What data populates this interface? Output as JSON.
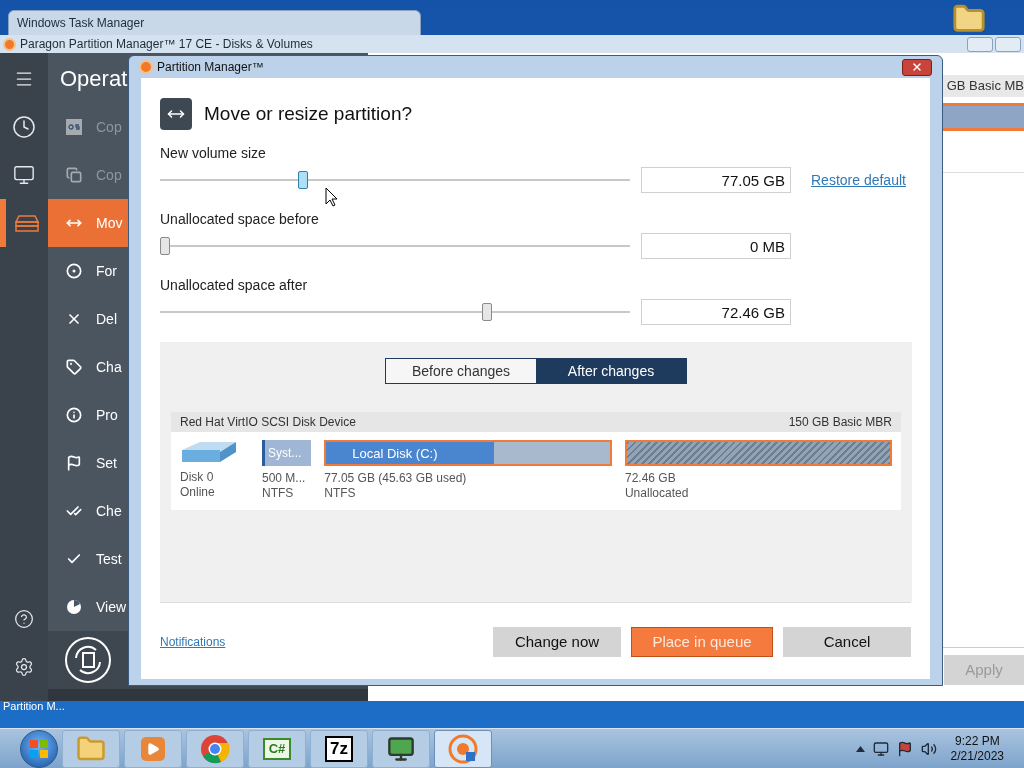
{
  "background_window": {
    "title": "Windows Task Manager"
  },
  "main_window": {
    "title": "Paragon Partition Manager™ 17 CE - Disks & Volumes",
    "rail": [
      {
        "kind": "menu",
        "selected": false
      },
      {
        "kind": "history",
        "selected": false
      },
      {
        "kind": "monitors",
        "selected": false
      },
      {
        "kind": "disks",
        "selected": true
      },
      {
        "kind": "help",
        "selected": false
      },
      {
        "kind": "settings",
        "selected": false
      }
    ],
    "panel": {
      "title": "Operat",
      "items": [
        {
          "kind": "os",
          "label": "Cop",
          "selected": false,
          "disabled": true
        },
        {
          "kind": "copy",
          "label": "Cop",
          "selected": false,
          "disabled": true
        },
        {
          "kind": "move",
          "label": "Mov",
          "selected": true,
          "disabled": false
        },
        {
          "kind": "format",
          "label": "For",
          "selected": false,
          "disabled": false
        },
        {
          "kind": "delete",
          "label": "Del",
          "selected": false,
          "disabled": false
        },
        {
          "kind": "tag",
          "label": "Cha",
          "selected": false,
          "disabled": false
        },
        {
          "kind": "info",
          "label": "Pro",
          "selected": false,
          "disabled": false
        },
        {
          "kind": "flag",
          "label": "Set",
          "selected": false,
          "disabled": false
        },
        {
          "kind": "checkall",
          "label": "Che",
          "selected": false,
          "disabled": false
        },
        {
          "kind": "check",
          "label": "Test",
          "selected": false,
          "disabled": false
        },
        {
          "kind": "pie",
          "label": "View",
          "selected": false,
          "disabled": false
        }
      ]
    },
    "disk_summary": "GB Basic MB",
    "apply_button": {
      "label": "Apply",
      "disabled": true
    }
  },
  "dialog": {
    "title": "Partition Manager™",
    "heading": "Move or resize partition?",
    "sliders": [
      {
        "label": "New volume size",
        "level": 0.3,
        "focused": true,
        "value": "77.05 GB",
        "link": "Restore default"
      },
      {
        "label": "Unallocated space before",
        "level": 0,
        "focused": false,
        "value": "0 MB"
      },
      {
        "label": "Unallocated space after",
        "level": 0.7,
        "focused": false,
        "value": "72.46 GB"
      }
    ],
    "tabs": [
      {
        "label": "Before changes",
        "selected": false
      },
      {
        "label": "After changes",
        "selected": true
      }
    ],
    "disk": {
      "name": "Red Hat VirtIO SCSI Disk Device",
      "summary": "150 GB Basic MBR",
      "label": "Disk 0",
      "status": "Online",
      "partitions": [
        {
          "kind": "system",
          "name": "Syst...",
          "size": "500 M...",
          "fs": "NTFS",
          "selected": false
        },
        {
          "kind": "volume",
          "name": "Local Disk (C:)",
          "level": 0.59,
          "size": "77.05 GB (45.63 GB used)",
          "fs": "NTFS",
          "selected": true
        },
        {
          "kind": "unallocated",
          "size": "72.46 GB",
          "fs": "Unallocated",
          "selected": true
        }
      ]
    },
    "notifications_link": "Notifications",
    "buttons": [
      {
        "label": "Change now",
        "primary": false
      },
      {
        "label": "Place in queue",
        "primary": true
      },
      {
        "label": "Cancel",
        "primary": false
      }
    ]
  },
  "desktop_label": "Partition M...",
  "taskbar": {
    "apps": [
      {
        "kind": "folder",
        "selected": false
      },
      {
        "kind": "media",
        "selected": false
      },
      {
        "kind": "chrome",
        "selected": false
      },
      {
        "kind": "code",
        "text": "C#",
        "selected": false
      },
      {
        "kind": "archive",
        "text": "7z",
        "selected": false
      },
      {
        "kind": "monitor",
        "selected": false
      },
      {
        "kind": "paragon",
        "selected": true
      }
    ],
    "time": "9:22 PM",
    "date": "2/21/2023"
  }
}
